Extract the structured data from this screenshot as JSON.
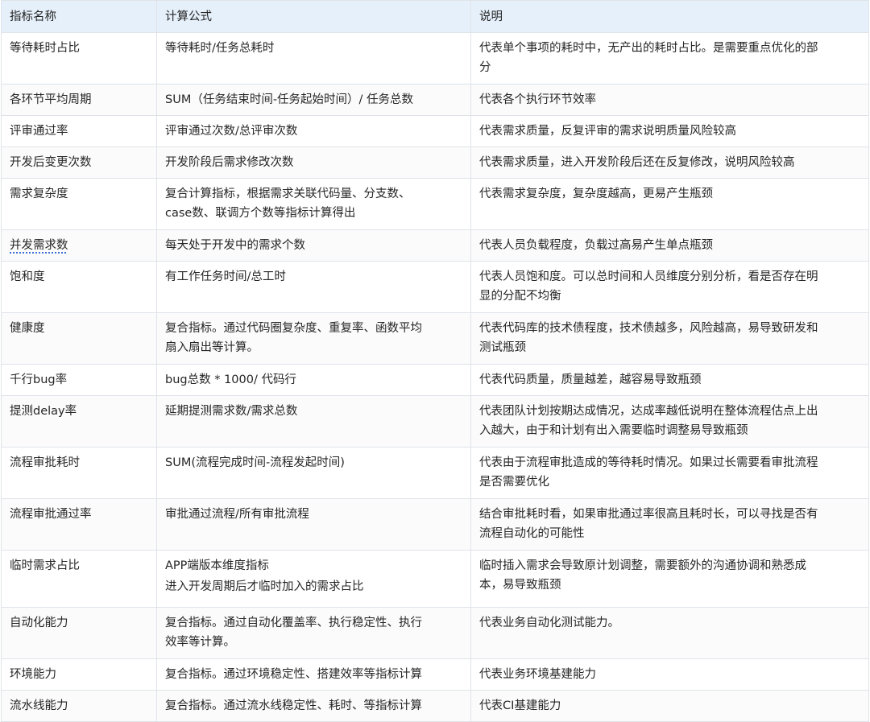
{
  "table": {
    "headers": [
      "指标名称",
      "计算公式",
      "说明"
    ],
    "rows": [
      {
        "name": "等待耗时占比",
        "formula": [
          "等待耗时/任务总耗时"
        ],
        "desc": [
          "代表单个事项的耗时中，无产出的耗时占比。是需要重点优化的部",
          "分"
        ]
      },
      {
        "name": "各环节平均周期",
        "formula": [
          "SUM（任务结束时间-任务起始时间）/ 任务总数"
        ],
        "desc": [
          "代表各个执行环节效率"
        ]
      },
      {
        "name": "评审通过率",
        "formula": [
          "评审通过次数/总评审次数"
        ],
        "desc": [
          "代表需求质量，反复评审的需求说明质量风险较高"
        ]
      },
      {
        "name": "开发后变更次数",
        "formula": [
          "开发阶段后需求修改次数"
        ],
        "desc": [
          "代表需求质量，进入开发阶段后还在反复修改，说明风险较高"
        ]
      },
      {
        "name": "需求复杂度",
        "formula": [
          "复合计算指标，根据需求关联代码量、分支数、",
          "case数、联调方个数等指标计算得出"
        ],
        "desc": [
          "代表需求复杂度，复杂度越高，更易产生瓶颈"
        ]
      },
      {
        "name": "并发需求数",
        "formula": [
          "每天处于开发中的需求个数"
        ],
        "desc": [
          "代表人员负载程度，负载过高易产生单点瓶颈"
        ]
      },
      {
        "name": "饱和度",
        "formula": [
          "有工作任务时间/总工时"
        ],
        "desc": [
          "代表人员饱和度。可以总时间和人员维度分别分析，看是否存在明",
          "显的分配不均衡"
        ]
      },
      {
        "name": "健康度",
        "formula": [
          "复合指标。通过代码圈复杂度、重复率、函数平均",
          "扇入扇出等计算。"
        ],
        "desc": [
          "代表代码库的技术债程度，技术债越多，风险越高，易导致研发和",
          "测试瓶颈"
        ]
      },
      {
        "name": "千行bug率",
        "formula": [
          "bug总数 * 1000/ 代码行"
        ],
        "desc": [
          "代表代码质量，质量越差，越容易导致瓶颈"
        ]
      },
      {
        "name": "提测delay率",
        "formula": [
          "延期提测需求数/需求总数"
        ],
        "desc": [
          "代表团队计划按期达成情况，达成率越低说明在整体流程估点上出",
          "入越大，由于和计划有出入需要临时调整易导致瓶颈"
        ]
      },
      {
        "name": "流程审批耗时",
        "formula": [
          "SUM(流程完成时间-流程发起时间)"
        ],
        "desc": [
          "代表由于流程审批造成的等待耗时情况。如果过长需要看审批流程",
          "是否需要优化"
        ]
      },
      {
        "name": "流程审批通过率",
        "formula": [
          "审批通过流程/所有审批流程"
        ],
        "desc": [
          "结合审批耗时看，如果审批通过率很高且耗时长，可以寻找是否有",
          "流程自动化的可能性"
        ]
      },
      {
        "name": "临时需求占比",
        "formula": [
          "APP端版本维度指标",
          "进入开发周期后才临时加入的需求占比"
        ],
        "desc": [
          "临时插入需求会导致原计划调整，需要额外的沟通协调和熟悉成",
          "本，易导致瓶颈"
        ]
      },
      {
        "name": "自动化能力",
        "formula": [
          "复合指标。通过自动化覆盖率、执行稳定性、执行",
          "效率等计算。"
        ],
        "desc": [
          "代表业务自动化测试能力。"
        ]
      },
      {
        "name": "环境能力",
        "formula": [
          "复合指标。通过环境稳定性、搭建效率等指标计算"
        ],
        "desc": [
          "代表业务环境基建能力"
        ]
      },
      {
        "name": "流水线能力",
        "formula": [
          "复合指标。通过流水线稳定性、耗时、等指标计算"
        ],
        "desc": [
          "代表CI基建能力"
        ]
      }
    ]
  }
}
